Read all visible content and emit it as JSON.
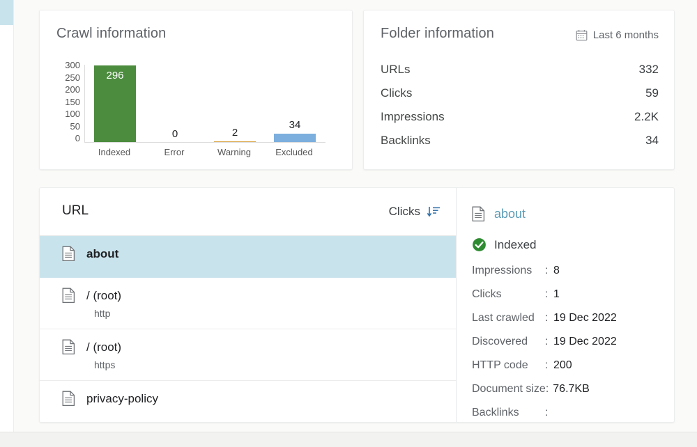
{
  "crawl_card": {
    "title": "Crawl information"
  },
  "chart_data": {
    "type": "bar",
    "title": "Crawl information",
    "xlabel": "",
    "ylabel": "",
    "categories": [
      "Indexed",
      "Error",
      "Warning",
      "Excluded"
    ],
    "values": [
      296,
      0,
      2,
      34
    ],
    "value_labels": [
      "296",
      "0",
      "2",
      "34"
    ],
    "colors": [
      "#4c8c3f",
      "#d9d9d9",
      "#d9a441",
      "#7cafdd"
    ],
    "yticks": [
      "300",
      "250",
      "200",
      "150",
      "100",
      "50",
      "0"
    ],
    "ylim": [
      0,
      300
    ],
    "grid": false,
    "legend": "none"
  },
  "folder_card": {
    "title": "Folder information",
    "range_icon": "calendar-icon",
    "range_label": "Last 6 months",
    "stats": [
      {
        "label": "URLs",
        "value": "332"
      },
      {
        "label": "Clicks",
        "value": "59"
      },
      {
        "label": "Impressions",
        "value": "2.2K"
      },
      {
        "label": "Backlinks",
        "value": "34"
      }
    ]
  },
  "url_panel": {
    "column_title": "URL",
    "sort_label": "Clicks",
    "sort_icon": "sort-descending-icon",
    "rows": [
      {
        "icon": "document-icon",
        "name": "about",
        "protocol": "",
        "selected": true
      },
      {
        "icon": "document-icon",
        "name": "/ (root)",
        "protocol": "http",
        "selected": false
      },
      {
        "icon": "document-icon",
        "name": "/ (root)",
        "protocol": "https",
        "selected": false
      },
      {
        "icon": "document-icon",
        "name": "privacy-policy",
        "protocol": "",
        "selected": false
      }
    ]
  },
  "detail_panel": {
    "icon": "document-icon",
    "url": "about",
    "status_icon": "check-circle-icon",
    "status": "Indexed",
    "fields": [
      {
        "key": "Impressions",
        "sep": ":",
        "value": "8"
      },
      {
        "key": "Clicks",
        "sep": ":",
        "value": "1"
      },
      {
        "key": "Last crawled",
        "sep": ":",
        "value": "19 Dec 2022"
      },
      {
        "key": "Discovered",
        "sep": ":",
        "value": "19 Dec 2022"
      },
      {
        "key": "HTTP code",
        "sep": ":",
        "value": "200"
      },
      {
        "key": "Document size:",
        "sep": "",
        "value": "76.7KB"
      },
      {
        "key": "Backlinks",
        "sep": ":",
        "value": ""
      }
    ]
  },
  "colors": {
    "indexed_green": "#4c8c3f",
    "excluded_blue": "#7cafdd",
    "warning_orange": "#d9a441",
    "selection_blue": "#c9e3ec",
    "link_blue": "#5b9bb5",
    "status_green": "#2e8b31"
  }
}
